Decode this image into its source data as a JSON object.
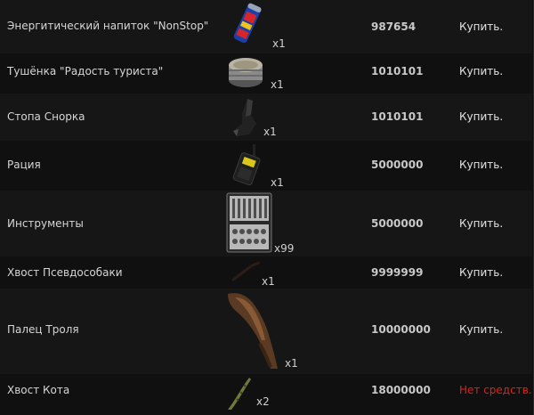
{
  "items": [
    {
      "name": "Энергитический напиток \"NonStop\"",
      "icon": "energy-drink-can-icon",
      "qty": "x1",
      "price": "987654",
      "action": "Купить."
    },
    {
      "name": "Тушёнка \"Радость туриста\"",
      "icon": "canned-meat-icon",
      "qty": "x1",
      "price": "1010101",
      "action": "Купить."
    },
    {
      "name": "Стопа Снорка",
      "icon": "snork-foot-icon",
      "qty": "x1",
      "price": "1010101",
      "action": "Купить."
    },
    {
      "name": "Рация",
      "icon": "radio-icon",
      "qty": "x1",
      "price": "5000000",
      "action": "Купить."
    },
    {
      "name": "Инструменты",
      "icon": "toolkit-icon",
      "qty": "x99",
      "price": "5000000",
      "action": "Купить."
    },
    {
      "name": "Хвост Псевдособаки",
      "icon": "pseudodog-tail-icon",
      "qty": "x1",
      "price": "9999999",
      "action": "Купить."
    },
    {
      "name": "Палец Троля",
      "icon": "troll-finger-icon",
      "qty": "x1",
      "price": "10000000",
      "action": "Купить."
    },
    {
      "name": "Хвост Кота",
      "icon": "cat-tail-icon",
      "qty": "x2",
      "price": "18000000",
      "action": "Нет средств."
    }
  ],
  "colors": {
    "buy": "#e2e2e2",
    "no_funds": "#e0201a",
    "row_alt": "#161616",
    "row_even": "#101010"
  }
}
